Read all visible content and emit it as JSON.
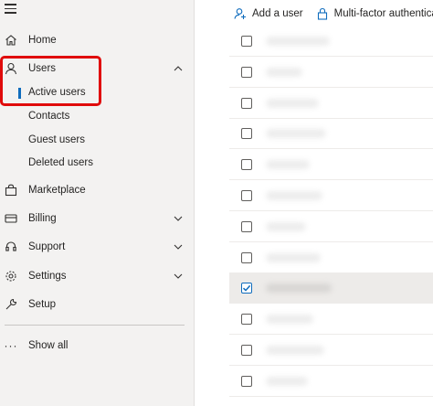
{
  "sidebar": {
    "items": [
      {
        "key": "home",
        "label": "Home",
        "icon": "home-icon"
      },
      {
        "key": "users",
        "label": "Users",
        "icon": "user-icon",
        "expanded": true
      },
      {
        "key": "marketplace",
        "label": "Marketplace",
        "icon": "shopping-bag-icon"
      },
      {
        "key": "billing",
        "label": "Billing",
        "icon": "credit-card-icon"
      },
      {
        "key": "support",
        "label": "Support",
        "icon": "headset-icon"
      },
      {
        "key": "settings",
        "label": "Settings",
        "icon": "gear-icon"
      },
      {
        "key": "setup",
        "label": "Setup",
        "icon": "wrench-icon"
      }
    ],
    "users_sub": [
      {
        "label": "Active users",
        "active": true
      },
      {
        "label": "Contacts"
      },
      {
        "label": "Guest users"
      },
      {
        "label": "Deleted users"
      }
    ],
    "show_all": "Show all"
  },
  "toolbar": {
    "add_user": "Add a user",
    "mfa": "Multi-factor authentica"
  },
  "table": {
    "row_count": 12,
    "selected_row_index": 8
  },
  "colors": {
    "accent": "#0f6cbd",
    "highlight_box": "#e00b0b",
    "sidebar_bg": "#f3f2f1"
  }
}
